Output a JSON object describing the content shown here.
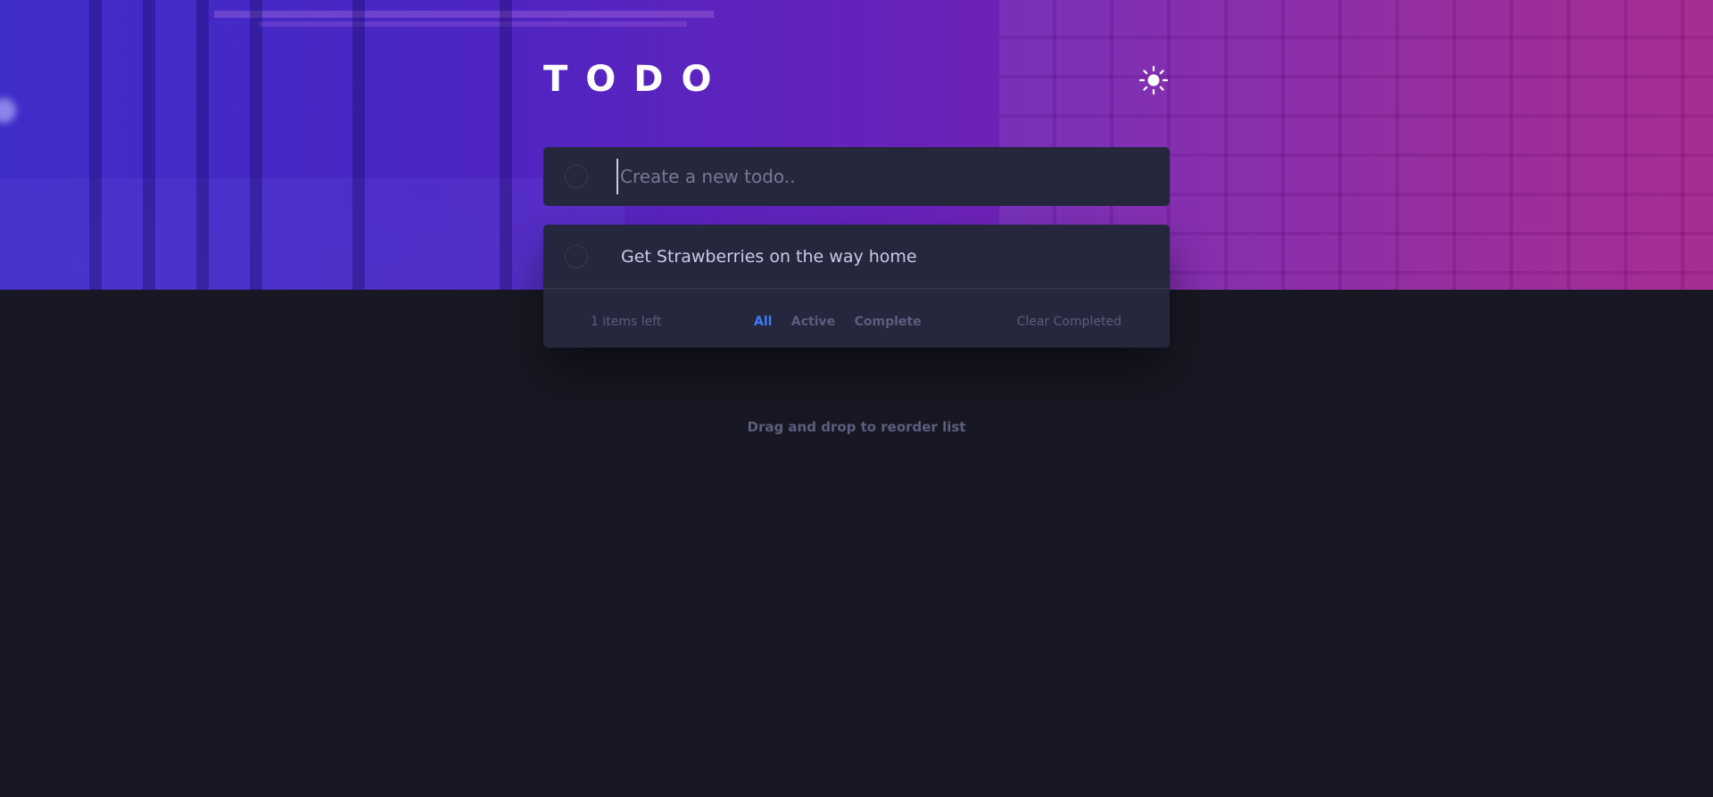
{
  "app": {
    "title": "TODO",
    "theme_icon": "sun-icon"
  },
  "new_todo": {
    "placeholder": "Create a new todo..",
    "value": ""
  },
  "todos": [
    {
      "text": "Get Strawberries on the way home",
      "completed": false
    }
  ],
  "footer": {
    "items_left": "1 items left",
    "filters": [
      "All",
      "Active",
      "Complete"
    ],
    "active_filter": "All",
    "clear_label": "Clear Completed"
  },
  "hint": "Drag and drop to reorder list",
  "colors": {
    "background": "#181824",
    "card": "#25273c",
    "text": "#c8cbe7",
    "muted": "#5b5e7e",
    "accent": "#3a7cfd"
  }
}
